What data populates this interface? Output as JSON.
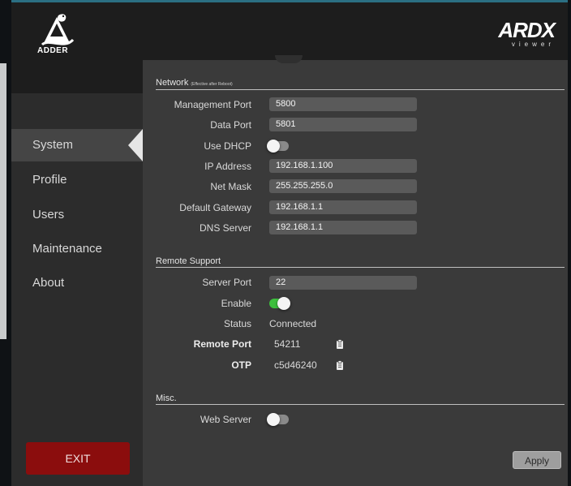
{
  "header": {
    "logo_text": "ADDER",
    "brand_big": "ARDX",
    "brand_small": "viewer"
  },
  "sidebar": {
    "items": [
      {
        "label": "System",
        "active": true
      },
      {
        "label": "Profile"
      },
      {
        "label": "Users"
      },
      {
        "label": "Maintenance"
      },
      {
        "label": "About"
      }
    ],
    "exit_label": "EXIT"
  },
  "network": {
    "title": "Network",
    "subtitle": "(Effective after Reboot)",
    "management_port_label": "Management Port",
    "management_port": "5800",
    "data_port_label": "Data Port",
    "data_port": "5801",
    "use_dhcp_label": "Use DHCP",
    "use_dhcp": false,
    "ip_address_label": "IP Address",
    "ip_address": "192.168.1.100",
    "net_mask_label": "Net Mask",
    "net_mask": "255.255.255.0",
    "gateway_label": "Default Gateway",
    "gateway": "192.168.1.1",
    "dns_label": "DNS Server",
    "dns": "192.168.1.1"
  },
  "remote_support": {
    "title": "Remote Support",
    "server_port_label": "Server Port",
    "server_port": "22",
    "enable_label": "Enable",
    "enable": true,
    "status_label": "Status",
    "status": "Connected",
    "remote_port_label": "Remote Port",
    "remote_port": "54211",
    "otp_label": "OTP",
    "otp": "c5d46240"
  },
  "misc": {
    "title": "Misc.",
    "web_server_label": "Web Server",
    "web_server": false
  },
  "apply_label": "Apply",
  "icons": {
    "copy": "clipboard-icon",
    "active_arrow": "chevron-left-icon"
  },
  "colors": {
    "toggle_on": "#3dbf3d",
    "exit": "#8b0d0d",
    "accent": "#2b6f83"
  }
}
